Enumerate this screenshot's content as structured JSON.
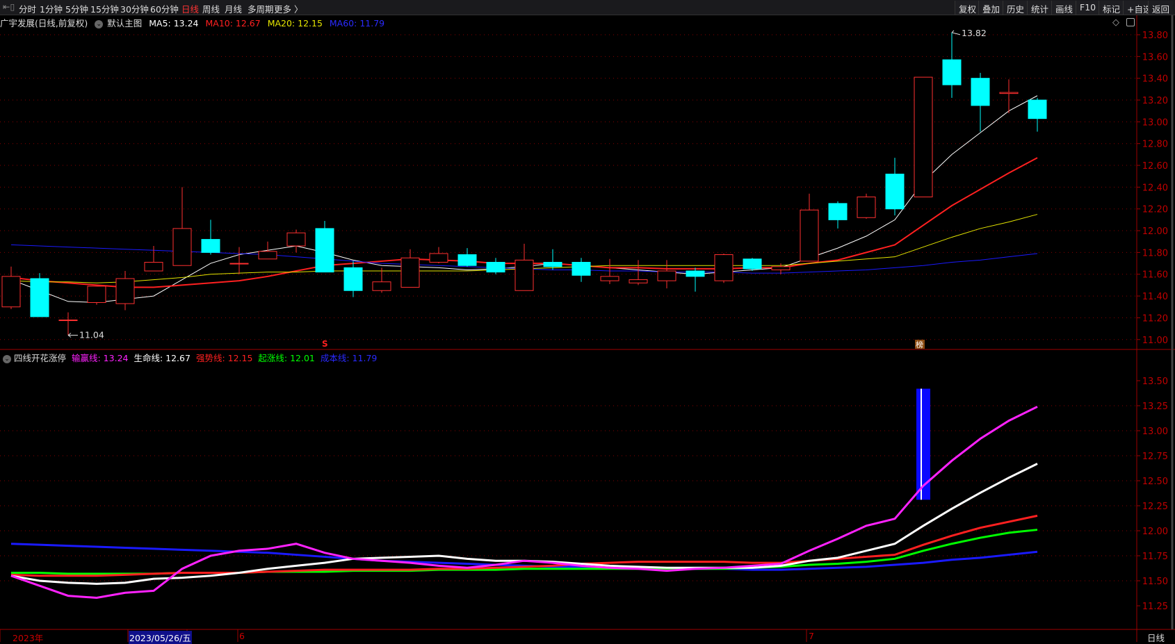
{
  "toolbar": {
    "periods": [
      "分时",
      "1分钟",
      "5分钟",
      "15分钟",
      "30分钟",
      "60分钟",
      "日线",
      "周线",
      "月线",
      "多周期",
      "更多 〉"
    ],
    "active_period": "日线",
    "right_buttons": [
      "复权",
      "叠加",
      "历史",
      "统计",
      "画线",
      "F10",
      "标记",
      "+自选",
      "返回"
    ]
  },
  "header": {
    "stock": "广宇发展(日线,前复权)",
    "template": "默认主图",
    "ma5": "MA5: 13.24",
    "ma10": "MA10: 12.67",
    "ma20": "MA20: 12.15",
    "ma60": "MA60: 11.79"
  },
  "indicator": {
    "name": "四线开花涨停",
    "l1": "输赢线: 13.24",
    "l2": "生命线: 12.67",
    "l3": "强势线: 12.15",
    "l4": "起涨线: 12.01",
    "l5": "成本线: 11.79"
  },
  "xaxis": {
    "year": "2023年",
    "cursor_date": "2023/05/26/五",
    "m6": "6",
    "m7": "7",
    "period": "日线"
  },
  "colors": {
    "up": "#ff3030",
    "down": "#00ffff",
    "ma5": "#ffffff",
    "ma10": "#ff2020",
    "ma20": "#e6e600",
    "ma60": "#1a1aff",
    "win": "#ff22ff",
    "green": "#00ff00"
  },
  "chart_data": [
    {
      "type": "candlestick",
      "title": "广宇发展 日线",
      "ylim": [
        10.95,
        13.88
      ],
      "yticks": [
        "13.80",
        "13.60",
        "13.40",
        "13.20",
        "13.00",
        "12.80",
        "12.60",
        "12.40",
        "12.20",
        "12.00",
        "11.80",
        "11.60",
        "11.40",
        "11.20",
        "11.00"
      ],
      "annotations": {
        "high": "13.82",
        "low": "11.04",
        "s_mark": "S",
        "bang_mark": "榜"
      },
      "ohlc": [
        [
          11.3,
          11.67,
          11.28,
          11.58
        ],
        [
          11.56,
          11.61,
          11.21,
          11.21
        ],
        [
          11.18,
          11.25,
          11.04,
          11.18
        ],
        [
          11.34,
          11.43,
          11.32,
          11.49
        ],
        [
          11.33,
          11.63,
          11.27,
          11.56
        ],
        [
          11.63,
          11.86,
          11.63,
          11.71
        ],
        [
          11.68,
          12.4,
          11.68,
          12.02
        ],
        [
          11.92,
          12.1,
          11.78,
          11.8
        ],
        [
          11.7,
          11.85,
          11.6,
          11.7
        ],
        [
          11.74,
          11.9,
          11.74,
          11.81
        ],
        [
          11.86,
          12.01,
          11.8,
          11.98
        ],
        [
          12.02,
          12.09,
          11.62,
          11.62
        ],
        [
          11.66,
          11.72,
          11.39,
          11.45
        ],
        [
          11.45,
          11.66,
          11.43,
          11.53
        ],
        [
          11.48,
          11.83,
          11.48,
          11.75
        ],
        [
          11.71,
          11.85,
          11.7,
          11.79
        ],
        [
          11.78,
          11.84,
          11.67,
          11.68
        ],
        [
          11.71,
          11.75,
          11.6,
          11.62
        ],
        [
          11.45,
          11.88,
          11.45,
          11.73
        ],
        [
          11.71,
          11.83,
          11.64,
          11.67
        ],
        [
          11.71,
          11.75,
          11.53,
          11.59
        ],
        [
          11.54,
          11.74,
          11.51,
          11.58
        ],
        [
          11.52,
          11.73,
          11.5,
          11.55
        ],
        [
          11.54,
          11.73,
          11.47,
          11.63
        ],
        [
          11.63,
          11.66,
          11.44,
          11.58
        ],
        [
          11.54,
          11.79,
          11.52,
          11.78
        ],
        [
          11.74,
          11.75,
          11.63,
          11.65
        ],
        [
          11.64,
          11.7,
          11.6,
          11.67
        ],
        [
          11.72,
          12.34,
          11.72,
          12.19
        ],
        [
          12.25,
          12.27,
          12.02,
          12.1
        ],
        [
          12.12,
          12.34,
          12.11,
          12.31
        ],
        [
          12.52,
          12.67,
          12.14,
          12.2
        ],
        [
          12.31,
          13.41,
          12.31,
          13.41
        ],
        [
          13.57,
          13.82,
          13.22,
          13.34
        ],
        [
          13.4,
          13.45,
          12.91,
          13.15
        ],
        [
          13.26,
          13.39,
          13.08,
          13.27
        ],
        [
          13.2,
          13.22,
          12.91,
          13.03
        ]
      ],
      "series": [
        {
          "name": "MA5",
          "values": [
            11.55,
            11.45,
            11.35,
            11.34,
            11.37,
            11.4,
            11.55,
            11.7,
            11.78,
            11.82,
            11.86,
            11.8,
            11.73,
            11.68,
            11.67,
            11.66,
            11.64,
            11.65,
            11.67,
            11.7,
            11.68,
            11.66,
            11.64,
            11.62,
            11.6,
            11.62,
            11.64,
            11.66,
            11.75,
            11.84,
            11.95,
            12.1,
            12.45,
            12.7,
            12.9,
            13.1,
            13.24
          ]
        },
        {
          "name": "MA10",
          "values": [
            11.57,
            11.54,
            11.52,
            11.5,
            11.48,
            11.48,
            11.5,
            11.52,
            11.54,
            11.58,
            11.63,
            11.68,
            11.7,
            11.72,
            11.74,
            11.73,
            11.72,
            11.7,
            11.7,
            11.7,
            11.68,
            11.66,
            11.66,
            11.65,
            11.65,
            11.65,
            11.66,
            11.66,
            11.7,
            11.73,
            11.8,
            11.87,
            12.05,
            12.23,
            12.38,
            12.53,
            12.67
          ]
        },
        {
          "name": "MA20",
          "values": [
            11.54,
            11.53,
            11.53,
            11.52,
            11.53,
            11.55,
            11.57,
            11.6,
            11.61,
            11.62,
            11.62,
            11.63,
            11.63,
            11.63,
            11.63,
            11.63,
            11.63,
            11.64,
            11.65,
            11.66,
            11.67,
            11.68,
            11.68,
            11.68,
            11.68,
            11.68,
            11.68,
            11.68,
            11.7,
            11.72,
            11.74,
            11.76,
            11.85,
            11.94,
            12.02,
            12.08,
            12.15
          ]
        },
        {
          "name": "MA60",
          "values": [
            11.87,
            11.86,
            11.85,
            11.84,
            11.83,
            11.82,
            11.81,
            11.8,
            11.79,
            11.78,
            11.76,
            11.74,
            11.72,
            11.7,
            11.69,
            11.68,
            11.67,
            11.66,
            11.65,
            11.64,
            11.64,
            11.63,
            11.63,
            11.62,
            11.62,
            11.62,
            11.61,
            11.61,
            11.62,
            11.63,
            11.64,
            11.66,
            11.68,
            11.71,
            11.73,
            11.76,
            11.79
          ]
        }
      ]
    },
    {
      "type": "line",
      "title": "四线开花涨停",
      "ylim": [
        11.1,
        13.8
      ],
      "yticks": [
        "13.50",
        "13.25",
        "13.00",
        "12.75",
        "12.50",
        "12.25",
        "12.00",
        "11.75",
        "11.50",
        "11.25"
      ],
      "bar": {
        "index": 32,
        "from": 12.31,
        "to": 13.42
      },
      "series": [
        {
          "name": "输赢线",
          "values": [
            11.55,
            11.45,
            11.35,
            11.33,
            11.38,
            11.4,
            11.62,
            11.75,
            11.8,
            11.82,
            11.87,
            11.78,
            11.72,
            11.7,
            11.68,
            11.65,
            11.63,
            11.66,
            11.7,
            11.68,
            11.65,
            11.63,
            11.62,
            11.6,
            11.62,
            11.63,
            11.65,
            11.67,
            11.8,
            11.92,
            12.05,
            12.12,
            12.45,
            12.7,
            12.92,
            13.1,
            13.24
          ]
        },
        {
          "name": "生命线",
          "values": [
            11.55,
            11.5,
            11.48,
            11.47,
            11.48,
            11.52,
            11.53,
            11.55,
            11.58,
            11.62,
            11.65,
            11.68,
            11.72,
            11.73,
            11.74,
            11.75,
            11.72,
            11.7,
            11.7,
            11.69,
            11.67,
            11.65,
            11.64,
            11.63,
            11.63,
            11.63,
            11.63,
            11.65,
            11.7,
            11.73,
            11.8,
            11.87,
            12.05,
            12.22,
            12.38,
            12.53,
            12.67
          ]
        },
        {
          "name": "强势线",
          "values": [
            11.56,
            11.55,
            11.55,
            11.55,
            11.56,
            11.57,
            11.58,
            11.58,
            11.58,
            11.59,
            11.6,
            11.61,
            11.61,
            11.61,
            11.61,
            11.62,
            11.62,
            11.63,
            11.64,
            11.65,
            11.67,
            11.68,
            11.69,
            11.69,
            11.69,
            11.69,
            11.68,
            11.68,
            11.7,
            11.72,
            11.74,
            11.76,
            11.86,
            11.95,
            12.03,
            12.09,
            12.15
          ]
        },
        {
          "name": "起涨线",
          "values": [
            11.58,
            11.58,
            11.57,
            11.57,
            11.57,
            11.57,
            11.58,
            11.58,
            11.58,
            11.59,
            11.59,
            11.59,
            11.6,
            11.6,
            11.6,
            11.61,
            11.61,
            11.61,
            11.62,
            11.62,
            11.62,
            11.62,
            11.62,
            11.62,
            11.62,
            11.62,
            11.63,
            11.64,
            11.66,
            11.67,
            11.69,
            11.72,
            11.8,
            11.87,
            11.93,
            11.98,
            12.01
          ]
        },
        {
          "name": "成本线",
          "values": [
            11.87,
            11.86,
            11.85,
            11.84,
            11.83,
            11.82,
            11.81,
            11.8,
            11.79,
            11.78,
            11.76,
            11.74,
            11.72,
            11.7,
            11.69,
            11.68,
            11.67,
            11.66,
            11.65,
            11.64,
            11.64,
            11.63,
            11.63,
            11.62,
            11.62,
            11.62,
            11.61,
            11.61,
            11.62,
            11.63,
            11.64,
            11.66,
            11.68,
            11.71,
            11.73,
            11.76,
            11.79
          ]
        }
      ]
    }
  ]
}
